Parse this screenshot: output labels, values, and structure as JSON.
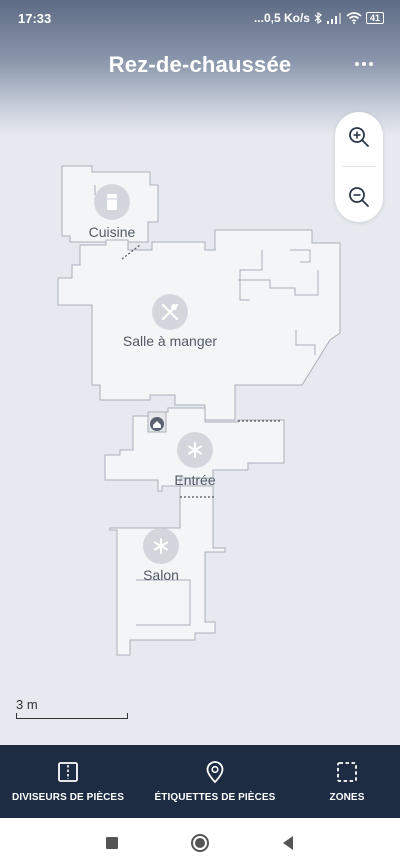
{
  "status_bar": {
    "time": "17:33",
    "network_speed": "...0,5 Ko/s",
    "battery": "41"
  },
  "header": {
    "title": "Rez-de-chaussée"
  },
  "map": {
    "rooms": [
      {
        "name": "Cuisine",
        "icon": "fridge-icon"
      },
      {
        "name": "Salle à manger",
        "icon": "utensils-icon"
      },
      {
        "name": "Entrée",
        "icon": "asterisk-icon"
      },
      {
        "name": "Salon",
        "icon": "asterisk-icon"
      }
    ],
    "dock_icon": "home-icon",
    "scale_label": "3 m"
  },
  "bottom_nav": {
    "items": [
      {
        "label": "DIVISEURS DE PIÈCES",
        "icon": "room-divider-icon"
      },
      {
        "label": "ÉTIQUETTES DE PIÈCES",
        "icon": "location-pin-icon"
      },
      {
        "label": "ZONES",
        "icon": "dashed-square-icon"
      }
    ]
  },
  "colors": {
    "map_floor": "#f4f5f7",
    "background": "#e6e9ef",
    "nav_bar": "#1d2b43",
    "room_icon_circle": "#d3d6dc"
  }
}
